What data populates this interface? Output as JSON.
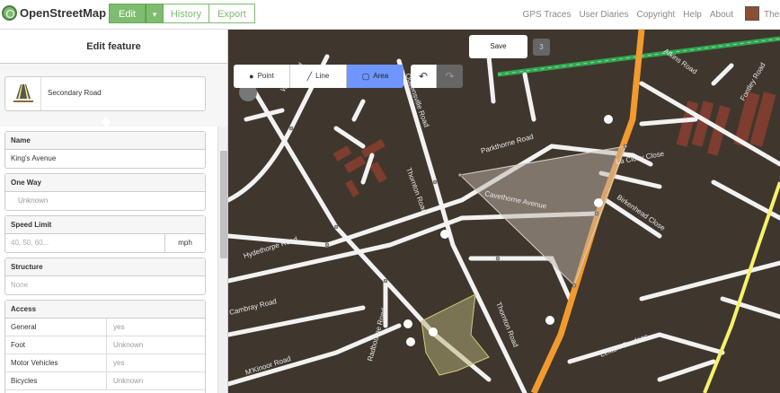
{
  "nav": {
    "brand": "OpenStreetMap",
    "edit_label": "Edit",
    "edit_caret": "▾",
    "history_label": "History",
    "export_label": "Export",
    "links": [
      "GPS Traces",
      "User Diaries",
      "Copyright",
      "Help",
      "About"
    ],
    "user": "Thei"
  },
  "sidebar": {
    "title": "Edit feature",
    "preset": "Secondary Road",
    "fields": {
      "name": {
        "label": "Name",
        "value": "King's Avenue"
      },
      "oneway": {
        "label": "One Way",
        "value": "Unknown"
      },
      "speed": {
        "label": "Speed Limit",
        "placeholder": "40, 50, 60...",
        "unit": "mph"
      },
      "structure": {
        "label": "Structure",
        "value": "None"
      },
      "access": {
        "label": "Access",
        "rows": [
          {
            "key": "General",
            "value": "yes"
          },
          {
            "key": "Foot",
            "value": "Unknown"
          },
          {
            "key": "Motor Vehicles",
            "value": "yes"
          },
          {
            "key": "Bicycles",
            "value": "Unknown"
          }
        ]
      }
    }
  },
  "map_toolbar": {
    "point_label": "Point",
    "line_label": "Line",
    "area_label": "Area",
    "undo_icon": "↶",
    "redo_icon": "↷",
    "save_label": "Save",
    "edit_count": "3",
    "active_mode": "Area"
  },
  "map_labels": [
    "Weir Road",
    "Queensville Road",
    "Parkthorne Road",
    "Thornton Road",
    "Cavethorne Avenue",
    "Hydethorpe Road",
    "Cambray Road",
    "Radbourne Road",
    "M'Kinoor Road",
    "Thornton Road",
    "La Cluny Close",
    "Birkenhead Close",
    "Lexton Gardens",
    "Atkins Road",
    "Fontley Road"
  ],
  "colors": {
    "accent_green": "#7ebc6f",
    "active_mode": "#6f96ff",
    "primary_road": "#f29a2e",
    "secondary_road": "#f7f26a",
    "rail": "#2fa84f"
  }
}
